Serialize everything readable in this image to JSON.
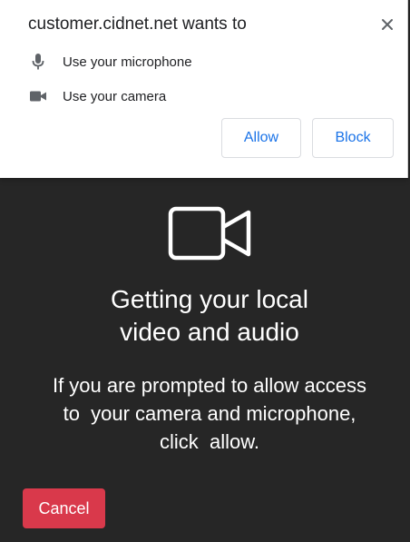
{
  "permission_popup": {
    "title": "customer.cidnet.net wants to",
    "close_icon": "close-icon",
    "permissions": [
      {
        "icon": "microphone-icon",
        "label": "Use your microphone"
      },
      {
        "icon": "camera-icon",
        "label": "Use your camera"
      }
    ],
    "allow_label": "Allow",
    "block_label": "Block",
    "button_text_color": "#1a73e8"
  },
  "main": {
    "icon": "video-camera-icon",
    "heading_line1": "Getting your local",
    "heading_line2": "video and audio",
    "instruction_line1": "If you are prompted to allow access",
    "instruction_line2": "to  your camera and microphone,",
    "instruction_line3": "click  allow.",
    "cancel_label": "Cancel",
    "background_color": "#262626",
    "cancel_color": "#d9394b"
  }
}
